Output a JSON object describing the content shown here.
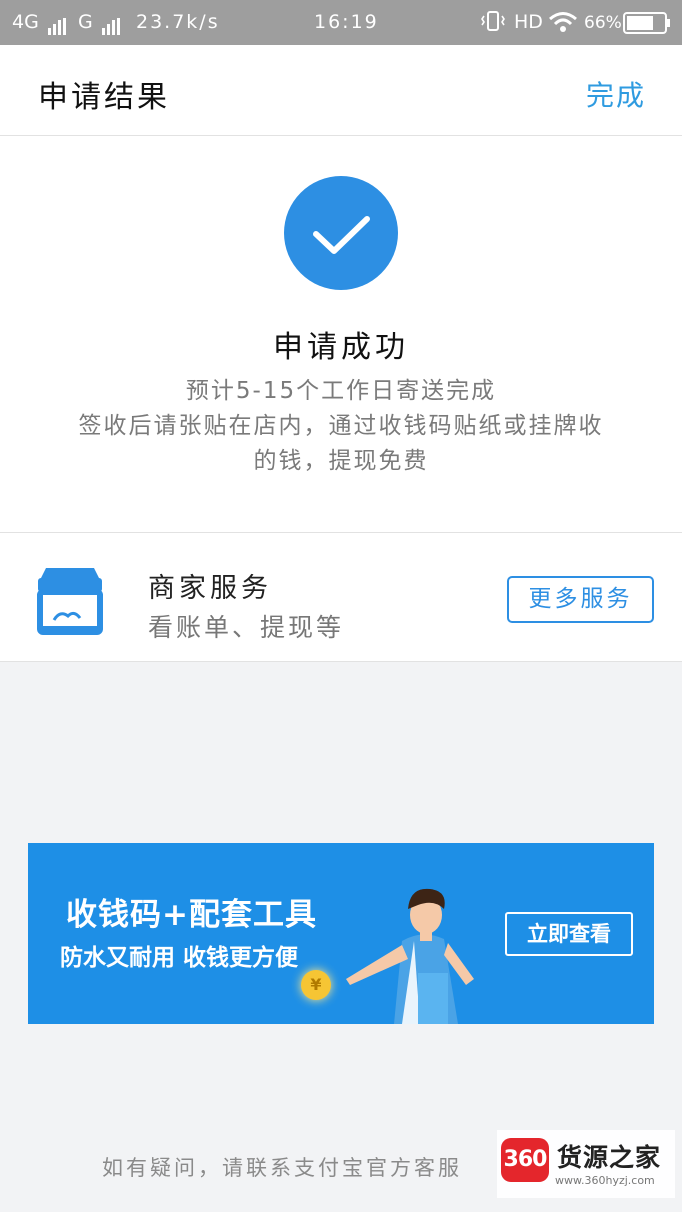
{
  "status_bar": {
    "network_4g": "4G",
    "network_g": "G",
    "speed": "23.7k/s",
    "time": "16:19",
    "hd": "HD",
    "battery": "66%"
  },
  "nav": {
    "title": "申请结果",
    "done_label": "完成"
  },
  "result": {
    "title": "申请成功",
    "line1": "预计5-15个工作日寄送完成",
    "line2": "签收后请张贴在店内，通过收钱码贴纸或挂牌收",
    "line3": "的钱，提现免费"
  },
  "service": {
    "title": "商家服务",
    "subtitle": "看账单、提现等",
    "more_label": "更多服务"
  },
  "banner": {
    "title": "收钱码+配套工具",
    "subtitle": "防水又耐用 收钱更方便",
    "button_label": "立即查看",
    "coin_symbol": "¥"
  },
  "footer": {
    "text": "如有疑问，请联系支付宝官方客服"
  },
  "watermark": {
    "badge": "360",
    "name": "货源之家",
    "url": "www.360hyzj.com"
  },
  "colors": {
    "accent": "#2d8fe3",
    "status_bar": "#9e9e9e",
    "banner_bg": "#1e8fe6"
  },
  "icons": {
    "check": "check-icon",
    "store": "store-icon",
    "wifi": "wifi-icon",
    "vibrate": "vibrate-icon",
    "battery": "battery-icon"
  }
}
